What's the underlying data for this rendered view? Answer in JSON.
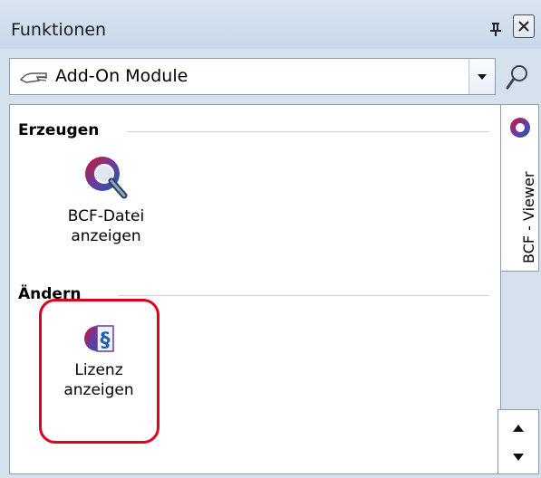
{
  "panel": {
    "title": "Funktionen"
  },
  "combo": {
    "selected": "Add-On Module"
  },
  "sections": [
    {
      "header": "Erzeugen",
      "tools": [
        {
          "label_line1": "BCF-Datei",
          "label_line2": "anzeigen"
        }
      ]
    },
    {
      "header": "Ändern",
      "tools": [
        {
          "label_line1": "Lizenz",
          "label_line2": "anzeigen"
        }
      ]
    }
  ],
  "side_tab": {
    "label": "BCF - Viewer"
  },
  "colors": {
    "highlight": "#e0001b",
    "brand_red": "#d0142c",
    "brand_purple": "#6b3aa0",
    "brand_blue": "#1b5fae"
  },
  "icons": {
    "pin": "pin-icon",
    "close": "close-icon",
    "combo": "hand-pointer-icon",
    "dropdown": "chevron-down-icon",
    "search": "search-icon",
    "bcf_view": "bcf-magnifier-icon",
    "license": "license-paragraph-icon",
    "tab": "bcf-logo-icon",
    "scroll_up": "arrow-up-icon",
    "scroll_down": "arrow-down-icon"
  }
}
